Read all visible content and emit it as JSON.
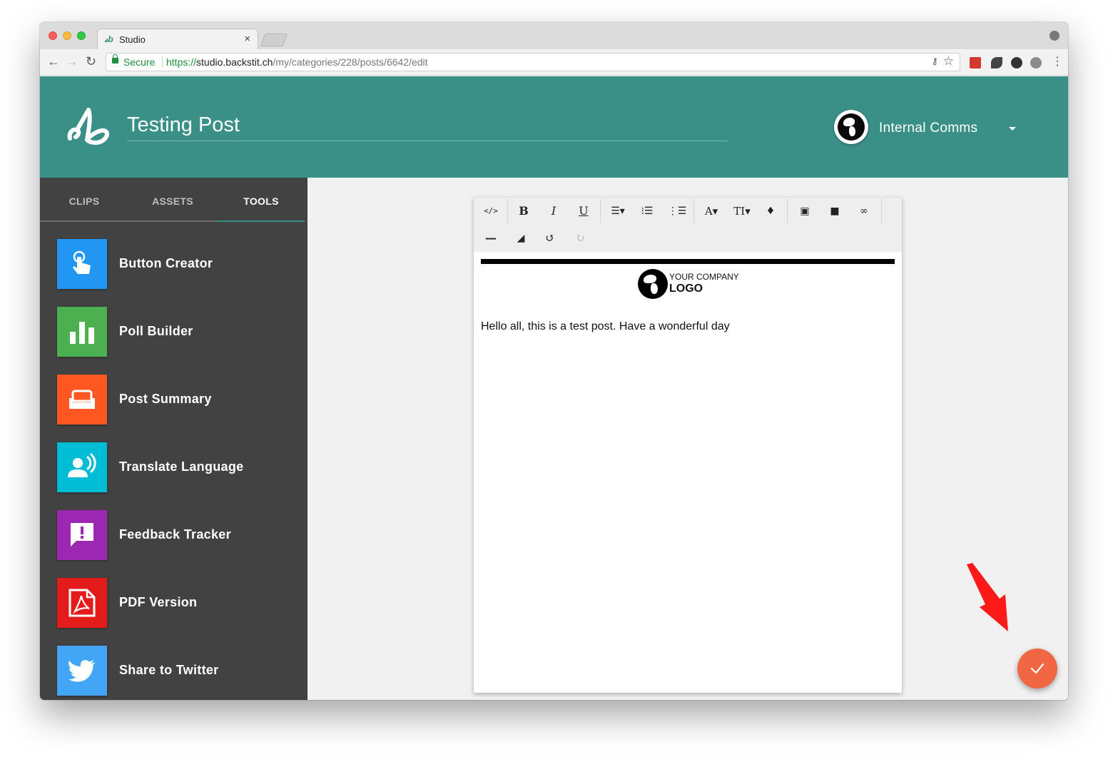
{
  "browser": {
    "tab_title": "Studio",
    "tab_favicon": "𝓈b",
    "secure_label": "Secure",
    "url_scheme": "https://",
    "url_host": "studio.backstit.ch",
    "url_path": "/my/categories/228/posts/6642/edit"
  },
  "header": {
    "logo_text": "𝒷",
    "post_title": "Testing Post",
    "org_name": "Internal Comms"
  },
  "sidebar": {
    "tabs": [
      "CLIPS",
      "ASSETS",
      "TOOLS"
    ],
    "active_tab": "TOOLS",
    "tools": [
      {
        "label": "Button Creator",
        "icon": "touch-icon",
        "color": "#2196f3"
      },
      {
        "label": "Poll Builder",
        "icon": "bar-chart-icon",
        "color": "#4caf50"
      },
      {
        "label": "Post Summary",
        "icon": "sofa-icon",
        "color": "#ff5722"
      },
      {
        "label": "Translate Language",
        "icon": "speaker-person-icon",
        "color": "#00bcd4"
      },
      {
        "label": "Feedback Tracker",
        "icon": "feedback-icon",
        "color": "#9c27b0"
      },
      {
        "label": "PDF Version",
        "icon": "pdf-icon",
        "color": "#e31b1b"
      },
      {
        "label": "Share to Twitter",
        "icon": "twitter-icon",
        "color": "#42a5f5"
      }
    ]
  },
  "editor": {
    "logo_line1": "YOUR COMPANY",
    "logo_line2": "LOGO",
    "body": "Hello all, this is a test post. Have a wonderful day"
  },
  "colors": {
    "header_bg": "#3a8f86",
    "sidebar_bg": "#424242",
    "fab": "#f26743",
    "annotation_arrow": "#ff1a1a"
  }
}
